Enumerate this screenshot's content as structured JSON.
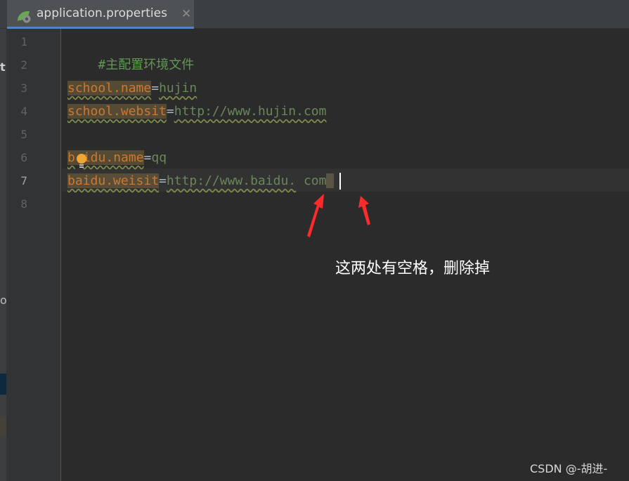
{
  "tab": {
    "title": "application.properties",
    "close": "✕",
    "icon": "spring-leaf-icon"
  },
  "left_strip": {
    "top_char": "t",
    "mid_char": "o"
  },
  "gutter": {
    "lines": [
      "1",
      "2",
      "3",
      "4",
      "5",
      "6",
      "7",
      "8"
    ],
    "active_line": "7"
  },
  "editor": {
    "line1": {
      "comment": "#主配置环境文件"
    },
    "line3": {
      "key": "school.name",
      "eq": "=",
      "value": "hujin"
    },
    "line4": {
      "key": "school.websit",
      "eq": "=",
      "value": "http://www.hujin.com"
    },
    "line6": {
      "key_a": "b",
      "key_b": "idu.name",
      "eq": "=",
      "value": "qq"
    },
    "line7": {
      "key": "baidu.weisit",
      "eq": "=",
      "value_a": "http://www.baidu.",
      "space1": " ",
      "value_b": "com",
      "space2": " "
    }
  },
  "annotation": "这两处有空格，删除掉",
  "watermark": "CSDN @-胡进-",
  "colors": {
    "keyword": "#cc7832",
    "value": "#6a8759",
    "arrow": "#ff2a2a",
    "tab_accent": "#4a88c7"
  }
}
